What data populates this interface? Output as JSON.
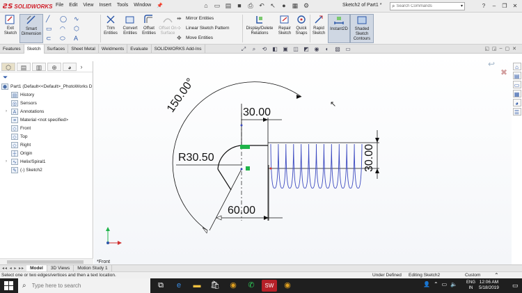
{
  "app": {
    "logo_mark": "ƧS",
    "logo_text": "SOLIDWORKS",
    "menu": [
      "File",
      "Edit",
      "View",
      "Insert",
      "Tools",
      "Window"
    ],
    "doc_title": "Sketch2 of Part1 *",
    "search_placeholder": "Search Commands",
    "search_icon": "magnifier-icon"
  },
  "command_manager": {
    "exit_sketch": "Exit Sketch",
    "smart_dimension": "Smart Dimension",
    "trim_entities": "Trim Entities",
    "convert_entities": "Convert Entities",
    "offset_entities": "Offset Entities",
    "offset_on_surface": "Offset On Surface",
    "mirror_entities": "Mirror Entities",
    "linear_sketch_pattern": "Linear Sketch Pattern",
    "move_entities": "Move Entities",
    "display_delete_relations": "Display/Delete Relations",
    "repair_sketch": "Repair Sketch",
    "quick_snaps": "Quick Snaps",
    "rapid_sketch": "Rapid Sketch",
    "instant2d": "Instant2D",
    "shaded_sketch_contours": "Shaded Sketch Contours"
  },
  "tabs": [
    "Features",
    "Sketch",
    "Surfaces",
    "Sheet Metal",
    "Weldments",
    "Evaluate",
    "SOLIDWORKS Add-Ins"
  ],
  "active_tab": "Sketch",
  "tree": {
    "root": "Part1  (Default<<Default>_PhotoWorks D",
    "items": [
      {
        "label": "History",
        "expand": ""
      },
      {
        "label": "Sensors",
        "expand": ""
      },
      {
        "label": "Annotations",
        "expand": "›"
      },
      {
        "label": "Material <not specified>",
        "expand": ""
      },
      {
        "label": "Front",
        "expand": ""
      },
      {
        "label": "Top",
        "expand": ""
      },
      {
        "label": "Right",
        "expand": ""
      },
      {
        "label": "Origin",
        "expand": ""
      },
      {
        "label": "Helix/Spiral1",
        "expand": "›"
      },
      {
        "label": "(-) Sketch2",
        "expand": ""
      }
    ]
  },
  "sketch": {
    "angle_dim": "150.00°",
    "top_dim": "30.00",
    "radius_dim": "R30.50",
    "bottom_dim": "60.00",
    "right_dim": "30.00",
    "view_label": "*Front",
    "spring_coils": 12
  },
  "bottom_tabs": [
    "Model",
    "3D Views",
    "Motion Study 1"
  ],
  "active_bottom_tab": "Model",
  "status": {
    "message": "Select one or two edges/vertices and then a text location.",
    "state": "Under Defined",
    "editing": "Editing Sketch2",
    "units": "Custom"
  },
  "taskbar": {
    "search_placeholder": "Type here to search",
    "lang_top": "ENG",
    "lang_bottom": "IN",
    "time": "12:06 AM",
    "date": "5/18/2019"
  }
}
